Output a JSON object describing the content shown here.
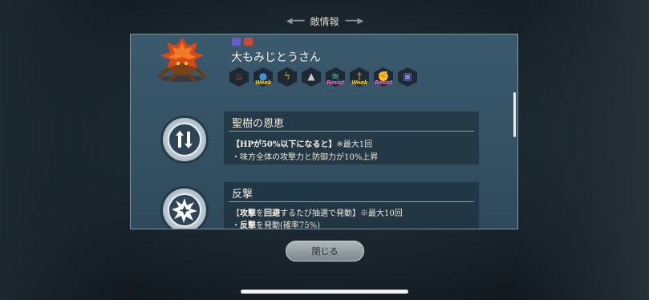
{
  "header": {
    "title": "敵情報"
  },
  "enemy": {
    "name": "大もみじとうさん",
    "affinities": [
      {
        "icon": "fire-icon",
        "color": "#e05a4a",
        "note": ""
      },
      {
        "icon": "water-icon",
        "color": "#4a8ee0",
        "note": "Weak"
      },
      {
        "icon": "thunder-icon",
        "color": "#f0c030",
        "note": ""
      },
      {
        "icon": "dark-icon",
        "color": "#c8c8d0",
        "note": ""
      },
      {
        "icon": "wind-icon",
        "color": "#40c8a0",
        "note": "Resist"
      },
      {
        "icon": "sword-icon",
        "color": "#d8c060",
        "note": "Weak"
      },
      {
        "icon": "fist-icon",
        "color": "#e08040",
        "note": "Resist"
      },
      {
        "icon": "magic-icon",
        "color": "#8080e0",
        "note": ""
      }
    ]
  },
  "skills": [
    {
      "title": "聖樹の恩恵",
      "icon": "stat-up-down-icon",
      "line1_bold": "【HPが50%以下になると】",
      "line1_rest": "※最大1回",
      "line2": "・味方全体の攻撃力と防御力が10%上昇"
    },
    {
      "title": "反撃",
      "icon": "counter-burst-icon",
      "line1_a": "【",
      "line1_b": "攻撃",
      "line1_c": "を",
      "line1_d": "回避",
      "line1_e": "するたび抽選で発動】※最大10回",
      "line2_a": "・",
      "line2_b": "反撃",
      "line2_c": "を発動(確率75%)"
    }
  ],
  "footer": {
    "close_label": "閉じる"
  }
}
